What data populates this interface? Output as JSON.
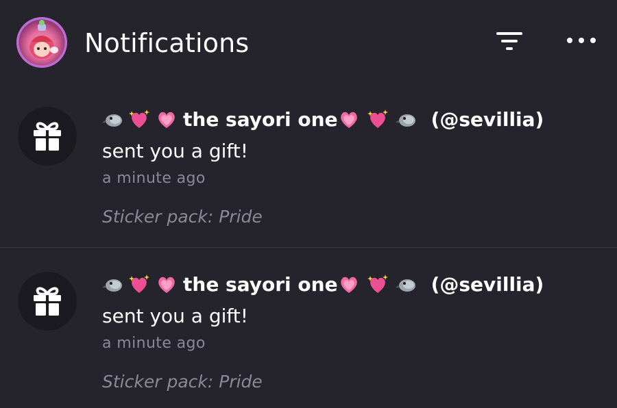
{
  "header": {
    "title": "Notifications",
    "avatar_icon": "profile-avatar-icon",
    "filter_icon": "filter-icon",
    "more_icon": "more-horizontal-icon"
  },
  "colors": {
    "background": "#25232c",
    "text": "#ffffff",
    "muted": "#8c8995",
    "icon_bg": "#1c1a21",
    "divider": "#38353f"
  },
  "notifications": [
    {
      "icon": "gift-icon",
      "username": "the sayori one",
      "leading_emoji": [
        "bird",
        "sparkling-heart",
        "growing-heart"
      ],
      "trailing_emoji": [
        "growing-heart",
        "sparkling-heart",
        "bird"
      ],
      "handle": "(@sevillia)",
      "message": "sent you a gift!",
      "time": "a minute ago",
      "detail": "Sticker pack: Pride"
    },
    {
      "icon": "gift-icon",
      "username": "the sayori one",
      "leading_emoji": [
        "bird",
        "sparkling-heart",
        "growing-heart"
      ],
      "trailing_emoji": [
        "growing-heart",
        "sparkling-heart",
        "bird"
      ],
      "handle": "(@sevillia)",
      "message": "sent you a gift!",
      "time": "a minute ago",
      "detail": "Sticker pack: Pride"
    }
  ]
}
